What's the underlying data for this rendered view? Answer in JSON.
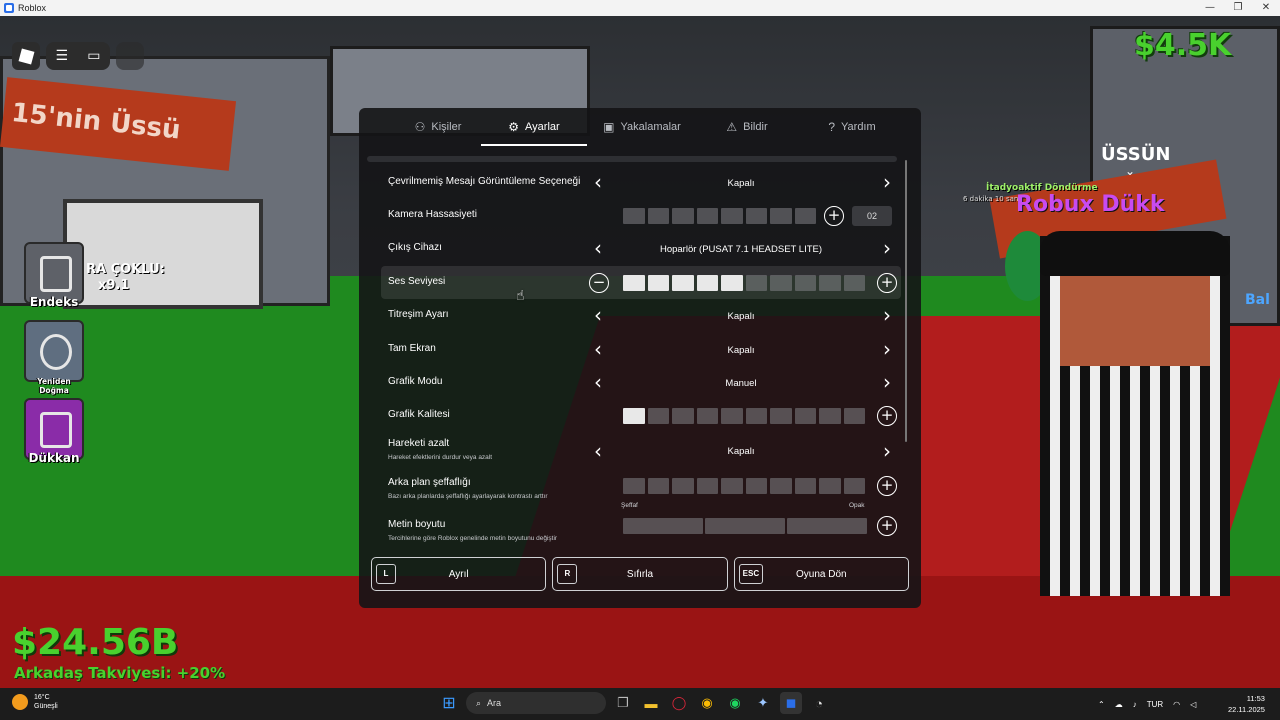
{
  "window": {
    "title": "Roblox",
    "controls": [
      "—",
      "❐",
      "✕"
    ]
  },
  "hud": {
    "money_top": "$4.5K",
    "money_bottom": "$24.56B",
    "boost": "Arkadaş Takviyesi: +20%",
    "endeks": "Endeks",
    "yeniden": "Yeniden Doğma",
    "dukkan": "Dükkan",
    "ra_coklu": "RA ÇOKLU:",
    "multiplier": "x9.1",
    "sign_left": "15'nin Üssü",
    "usun": "ÜSSÜN",
    "robux": "Robux Dükk",
    "aktif": "İtadyoaktif Döndürme",
    "aktif_time": "6 dakika 10 sani",
    "bal": "Bal"
  },
  "tabs": [
    {
      "icon": "people-icon",
      "glyph": "⚇",
      "label": "Kişiler"
    },
    {
      "icon": "gear-icon",
      "glyph": "⚙",
      "label": "Ayarlar"
    },
    {
      "icon": "camera-icon",
      "glyph": "▣",
      "label": "Yakalamalar"
    },
    {
      "icon": "report-icon",
      "glyph": "⚠",
      "label": "Bildir"
    },
    {
      "icon": "help-icon",
      "glyph": "?",
      "label": "Yardım"
    }
  ],
  "settings": {
    "unfiltered_chat": {
      "label": "Çevrilmemiş Mesajı Görüntüleme Seçeneği",
      "value": "Kapalı"
    },
    "camera_sensitivity": {
      "label": "Kamera Hassasiyeti",
      "value": "02",
      "level": 0.02
    },
    "output_device": {
      "label": "Çıkış Cihazı",
      "value": "Hoparlör (PUSAT 7.1 HEADSET LITE)"
    },
    "volume": {
      "label": "Ses Seviyesi",
      "level": 5,
      "max": 10
    },
    "vibration": {
      "label": "Titreşim Ayarı",
      "value": "Kapalı"
    },
    "fullscreen": {
      "label": "Tam Ekran",
      "value": "Kapalı"
    },
    "graphics_mode": {
      "label": "Grafik Modu",
      "value": "Manuel"
    },
    "graphics_quality": {
      "label": "Grafik Kalitesi",
      "level": 1,
      "max": 10
    },
    "reduce_motion": {
      "label": "Hareketi azalt",
      "sub": "Hareket efektlerini durdur veya azalt",
      "value": "Kapalı"
    },
    "bg_transparency": {
      "label": "Arka plan şeffaflığı",
      "sub": "Bazı arka planlarda şeffaflığı ayarlayarak kontrastı arttır",
      "level": 0,
      "max": 10,
      "min_label": "Şeffaf",
      "max_label": "Opak"
    },
    "text_size": {
      "label": "Metin boyutu",
      "sub": "Tercihlerine göre Roblox genelinde metin boyutunu değiştir",
      "level": 0,
      "max": 3
    }
  },
  "actions": [
    {
      "key": "L",
      "label": "Ayrıl"
    },
    {
      "key": "R",
      "label": "Sıfırla"
    },
    {
      "key": "ESC",
      "label": "Oyuna Dön"
    }
  ],
  "taskbar": {
    "temp": "16°C",
    "weather": "Güneşli",
    "search": "Ara",
    "lang": "TUR",
    "time": "11:53",
    "date": "22.11.2025"
  },
  "colors": {
    "money": "#49d12e",
    "panel": "#141416",
    "slider_on": "#e8e8e8"
  }
}
